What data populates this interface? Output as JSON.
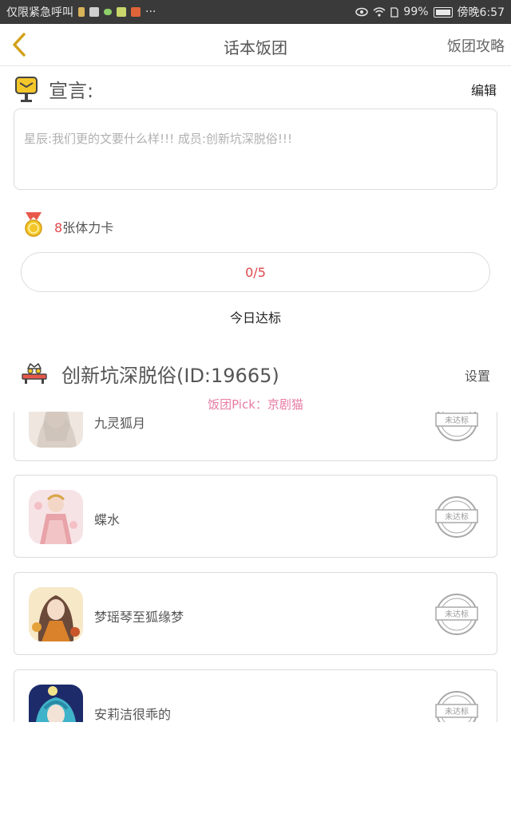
{
  "status_bar": {
    "left_text": "仅限紧急呼叫",
    "dots": "···",
    "battery": "99%",
    "time": "傍晚6:57"
  },
  "nav": {
    "title": "话本饭团",
    "right_link": "饭团攻略"
  },
  "manifesto": {
    "title": "宣言:",
    "edit_label": "编辑",
    "text": "星辰:我们更的文要什么样!!! 成员:创新坑深脱俗!!!"
  },
  "stamina": {
    "count": "8",
    "label": "张体力卡"
  },
  "progress": {
    "text": "0/5",
    "current": 0,
    "goal": 5
  },
  "daily_label": "今日达标",
  "group": {
    "name": "创新坑深脱俗(ID:19665)",
    "settings_label": "设置",
    "pick": "饭团Pick：京剧猫"
  },
  "members": [
    {
      "name": "九灵狐月",
      "stamp": "未达标",
      "avatar": "avatar-fox"
    },
    {
      "name": "蝶水",
      "stamp": "未达标",
      "avatar": "avatar-butterfly"
    },
    {
      "name": "梦瑶琴至狐缘梦",
      "stamp": "未达标",
      "avatar": "avatar-autumn"
    },
    {
      "name": "安莉洁很乖的",
      "stamp": "未达标",
      "avatar": "avatar-blue"
    }
  ],
  "colors": {
    "accent_red": "#e0474c",
    "pick_pink": "#e87aa2",
    "icon_yellow": "#f3c72a"
  }
}
